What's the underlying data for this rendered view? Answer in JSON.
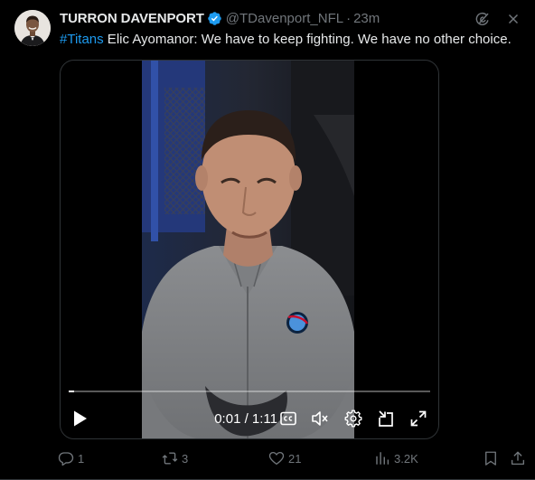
{
  "tweet": {
    "display_name": "TURRON DAVENPORT",
    "handle": "@TDavenport_NFL",
    "separator": "·",
    "time": "23m",
    "hashtag": "#Titans",
    "text": " Elic Ayomanor: We have to keep fighting. We have no other choice."
  },
  "video": {
    "current_time": "0:01 / 1:11",
    "progress_fraction": 0.015
  },
  "actions": {
    "replies": "1",
    "retweets": "3",
    "likes": "21",
    "views": "3.2K"
  },
  "colors": {
    "background": "#000000",
    "text": "#e7e9ea",
    "muted": "#71767b",
    "accent": "#1d9bf0",
    "border": "#2f3336"
  },
  "icons": {
    "verified": "verified-badge-icon",
    "grok": "grok-icon",
    "more": "more-icon",
    "play": "play-icon",
    "captions": "captions-icon",
    "mute": "mute-icon",
    "settings": "settings-icon",
    "pip": "picture-in-picture-icon",
    "fullscreen": "fullscreen-icon",
    "reply": "reply-icon",
    "retweet": "retweet-icon",
    "like": "heart-icon",
    "views": "views-icon",
    "bookmark": "bookmark-icon",
    "share": "share-icon"
  }
}
